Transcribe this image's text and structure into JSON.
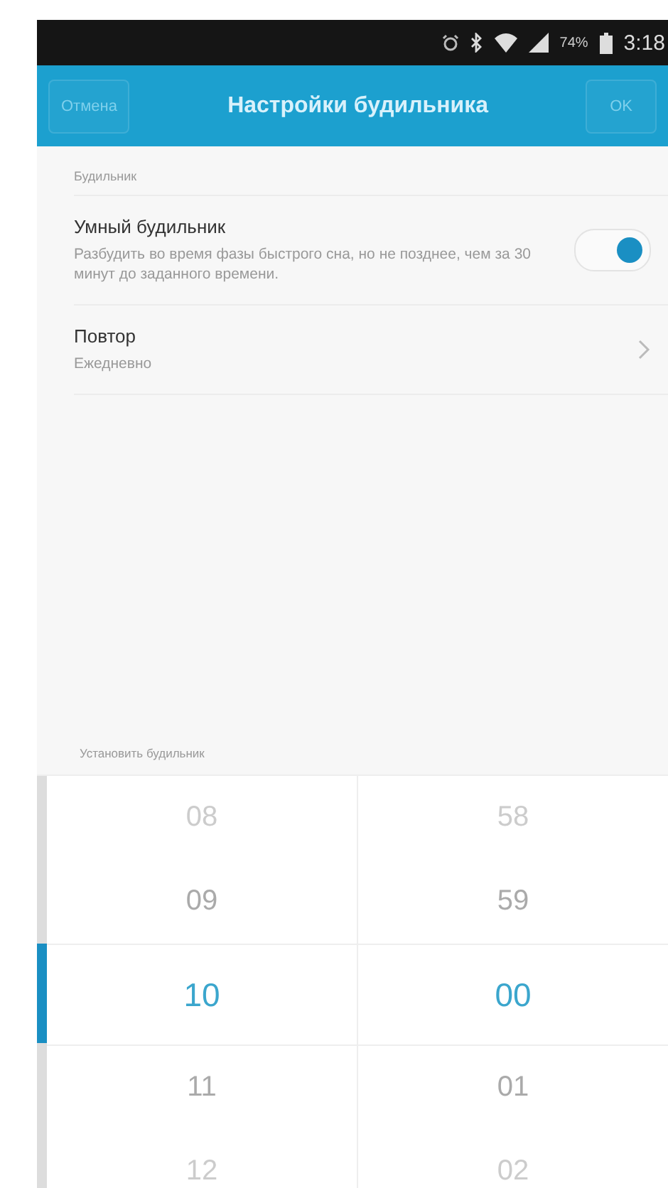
{
  "status_bar": {
    "battery_text": "74%",
    "time": "3:18"
  },
  "header": {
    "cancel": "Отмена",
    "title": "Настройки будильника",
    "ok": "OK"
  },
  "section_label": "Будильник",
  "settings": [
    {
      "kind": "toggle",
      "title": "Умный будильник",
      "subtitle": "Разбудить во время фазы быстрого сна, но не позднее, чем за 30 минут до заданного времени.",
      "on": true
    },
    {
      "kind": "link",
      "title": "Повтор",
      "subtitle": "Ежедневно"
    }
  ],
  "picker_label": "Установить будильник",
  "picker": [
    {
      "items": [
        {
          "text": "08",
          "selected": false
        },
        {
          "text": "09",
          "selected": false
        },
        {
          "text": "10",
          "selected": true
        },
        {
          "text": "11",
          "selected": false
        },
        {
          "text": "12",
          "selected": false
        }
      ]
    },
    {
      "items": [
        {
          "text": "58",
          "selected": false
        },
        {
          "text": "59",
          "selected": false
        },
        {
          "text": "00",
          "selected": true
        },
        {
          "text": "01",
          "selected": false
        },
        {
          "text": "02",
          "selected": false
        }
      ]
    }
  ]
}
